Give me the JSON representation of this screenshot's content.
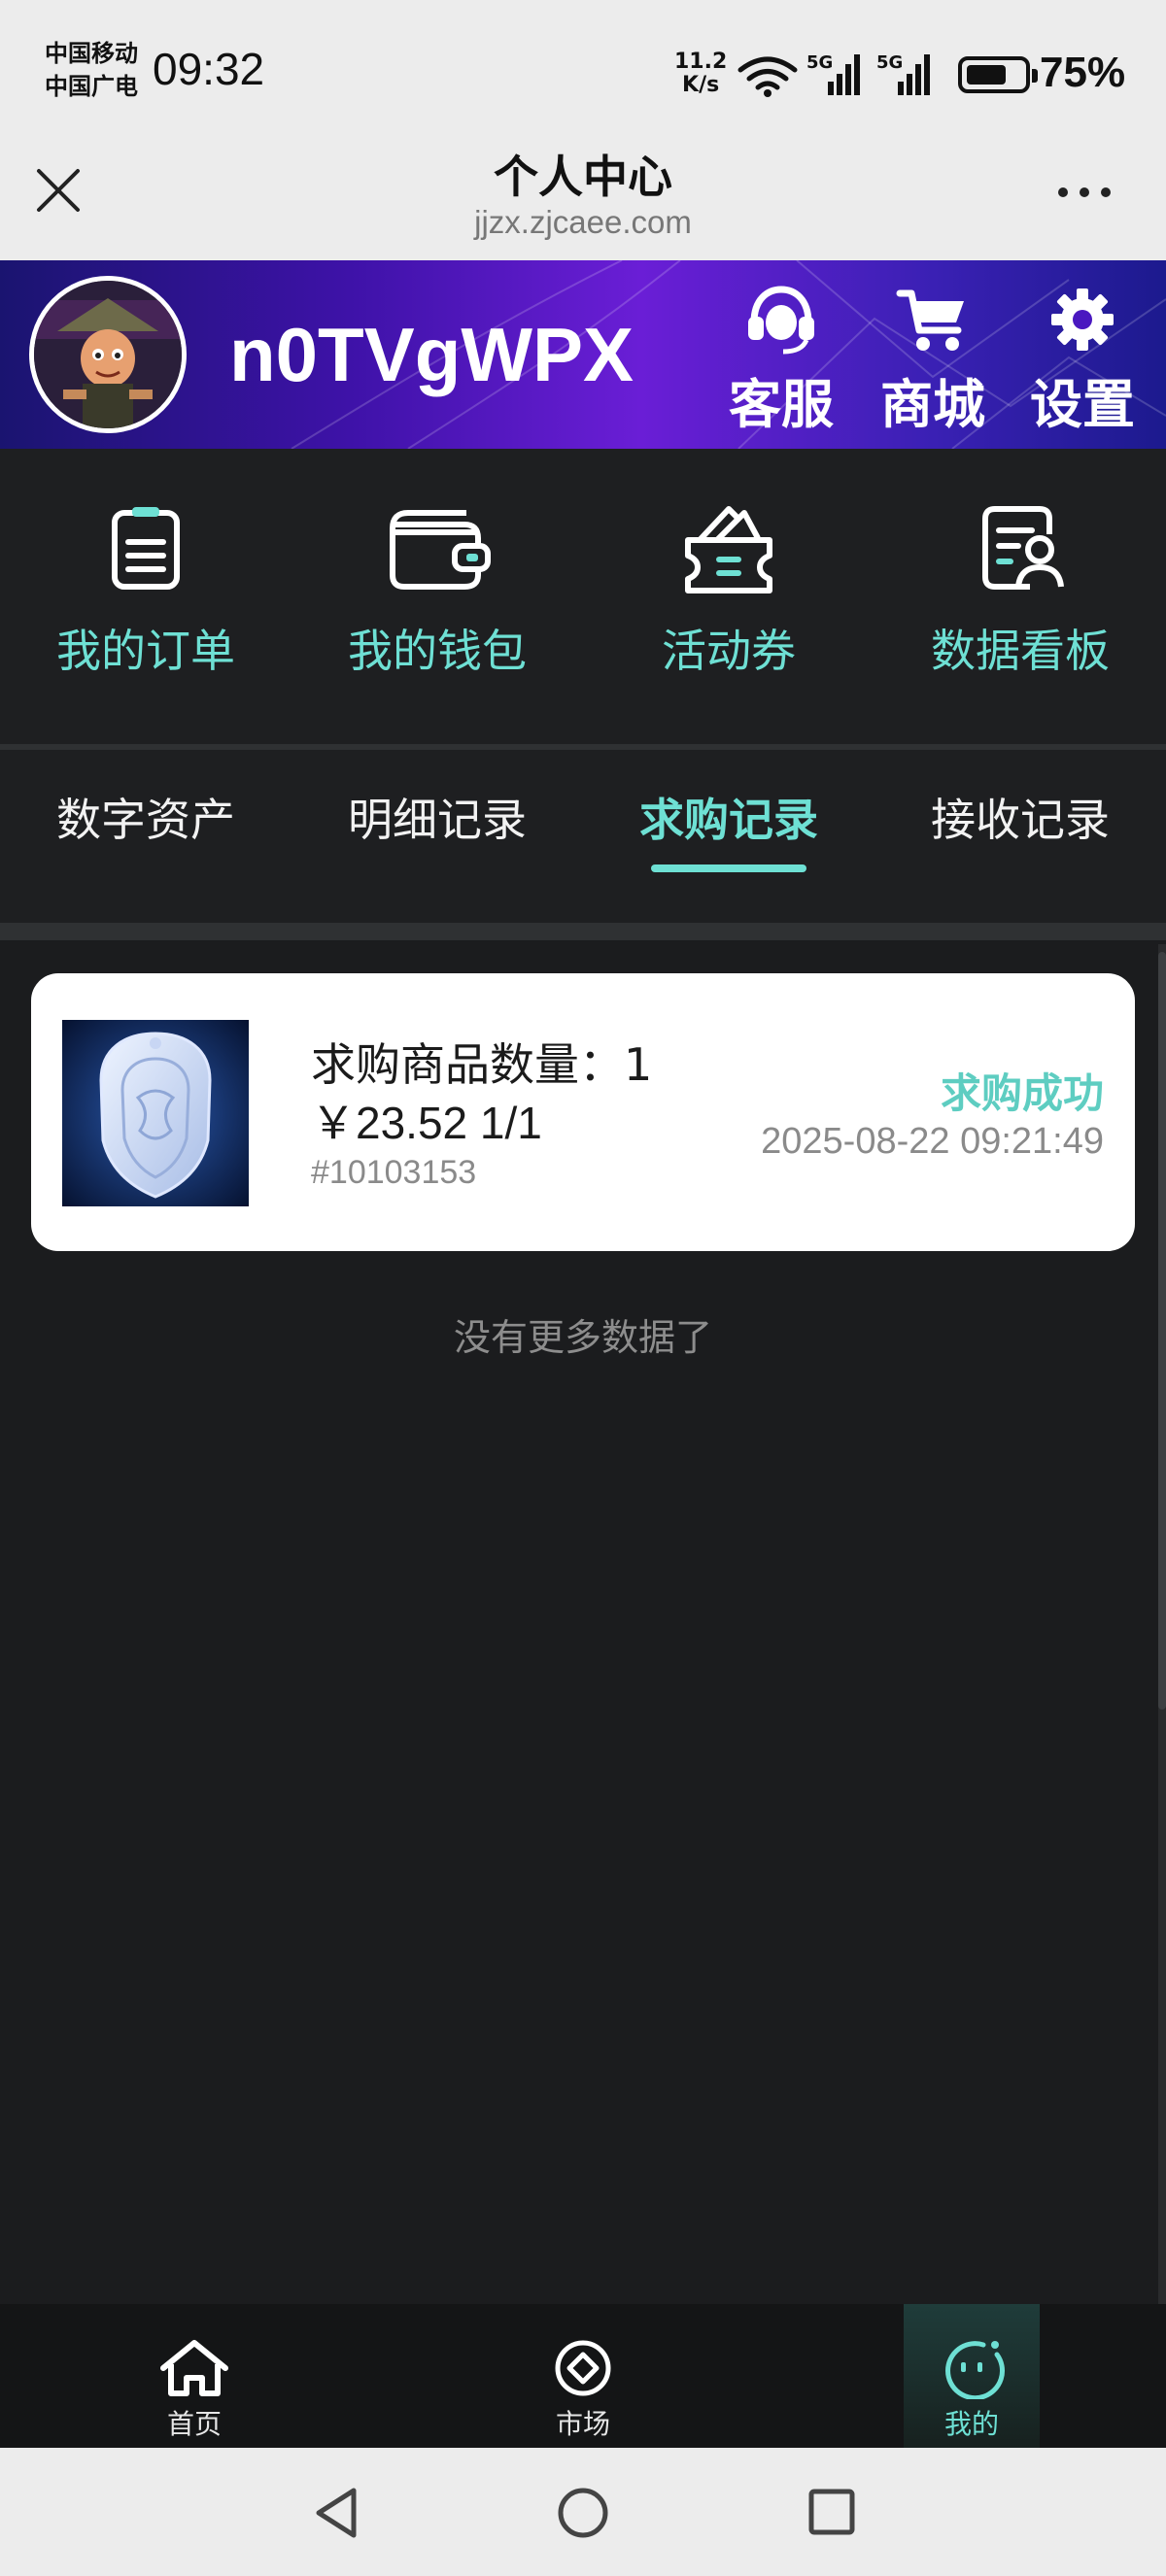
{
  "status_bar": {
    "carrier_1": "中国移动",
    "carrier_2": "中国广电",
    "time": "09:32",
    "net_speed_value": "11.2",
    "net_speed_unit": "K/s",
    "network_1": "5G",
    "network_2": "5G",
    "battery_percent": "75%",
    "battery_level": 0.75
  },
  "title_bar": {
    "title": "个人中心",
    "url": "jjzx.zjcaee.com",
    "close_icon": "close-icon",
    "more_icon": "more-horizontal-icon"
  },
  "profile": {
    "username": "n0TVgWPX",
    "actions": [
      {
        "label": "客服",
        "icon": "headset-icon"
      },
      {
        "label": "商城",
        "icon": "cart-icon"
      },
      {
        "label": "设置",
        "icon": "gear-icon"
      }
    ]
  },
  "quick_menu": [
    {
      "label": "我的订单",
      "icon": "clipboard-icon"
    },
    {
      "label": "我的钱包",
      "icon": "wallet-icon"
    },
    {
      "label": "活动券",
      "icon": "coupon-icon"
    },
    {
      "label": "数据看板",
      "icon": "dashboard-icon"
    }
  ],
  "tabs": [
    {
      "label": "数字资产",
      "active": false
    },
    {
      "label": "明细记录",
      "active": false
    },
    {
      "label": "求购记录",
      "active": true
    },
    {
      "label": "接收记录",
      "active": false
    }
  ],
  "records": [
    {
      "quantity_text": "求购商品数量：1",
      "price_text": "￥23.52 1/1",
      "id_text": "#10103153",
      "status": "求购成功",
      "time": "2025-08-22 09:21:49"
    }
  ],
  "no_more_text": "没有更多数据了",
  "bottom_nav": [
    {
      "label": "首页",
      "icon": "home-icon",
      "active": false
    },
    {
      "label": "市场",
      "icon": "market-icon",
      "active": false
    },
    {
      "label": "我的",
      "icon": "profile-face-icon",
      "active": true
    }
  ],
  "colors": {
    "accent": "#6ee0d4",
    "background": "#1b1c1e",
    "status_success": "#5ecdc1"
  }
}
